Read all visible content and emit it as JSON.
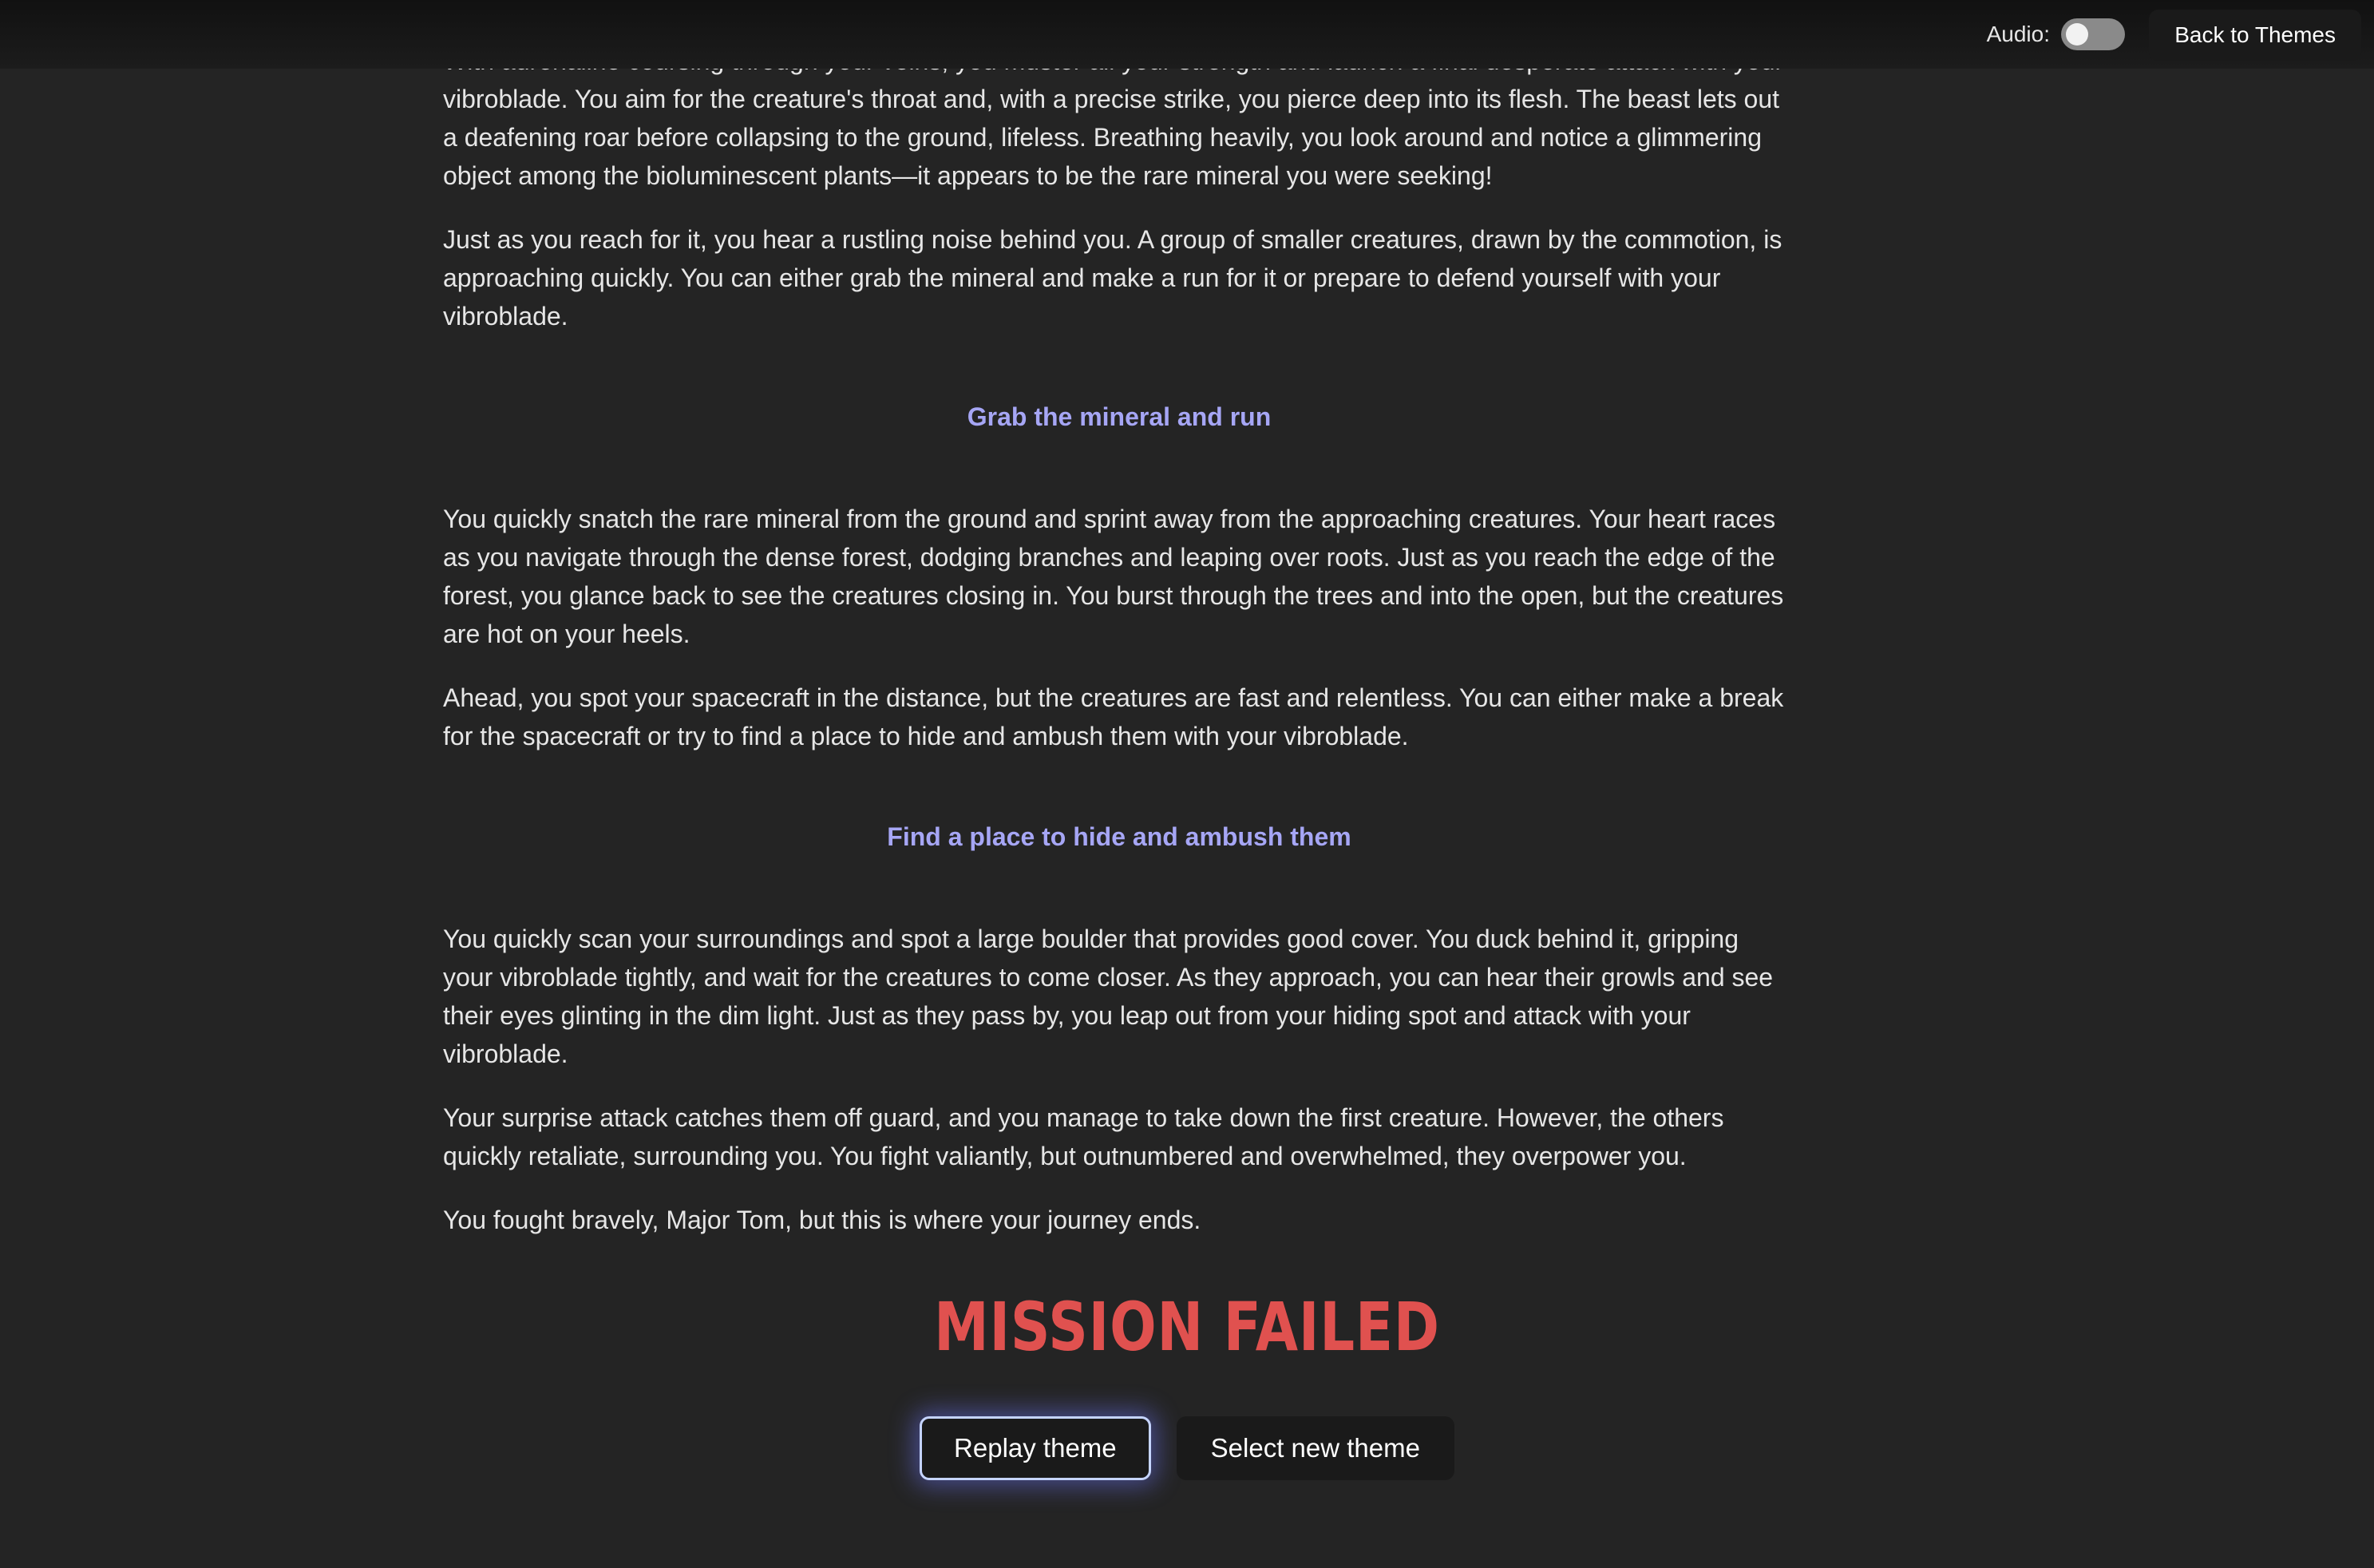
{
  "header": {
    "audio_label": "Audio:",
    "audio_on": false,
    "back_label": "Back to Themes"
  },
  "story": {
    "p1": "With adrenaline coursing through your veins, you muster all your strength and launch a final desperate attack with your vibroblade. You aim for the creature's throat and, with a precise strike, you pierce deep into its flesh. The beast lets out a deafening roar before collapsing to the ground, lifeless. Breathing heavily, you look around and notice a glimmering object among the bioluminescent plants—it appears to be the rare mineral you were seeking!",
    "p2": "Just as you reach for it, you hear a rustling noise behind you. A group of smaller creatures, drawn by the commotion, is approaching quickly. You can either grab the mineral and make a run for it or prepare to defend yourself with your vibroblade.",
    "choice1": "Grab the mineral and run",
    "p3": "You quickly snatch the rare mineral from the ground and sprint away from the approaching creatures. Your heart races as you navigate through the dense forest, dodging branches and leaping over roots. Just as you reach the edge of the forest, you glance back to see the creatures closing in. You burst through the trees and into the open, but the creatures are hot on your heels.",
    "p4": "Ahead, you spot your spacecraft in the distance, but the creatures are fast and relentless. You can either make a break for the spacecraft or try to find a place to hide and ambush them with your vibroblade.",
    "choice2": "Find a place to hide and ambush them",
    "p5": "You quickly scan your surroundings and spot a large boulder that provides good cover. You duck behind it, gripping your vibroblade tightly, and wait for the creatures to come closer. As they approach, you can hear their growls and see their eyes glinting in the dim light. Just as they pass by, you leap out from your hiding spot and attack with your vibroblade.",
    "p6": "Your surprise attack catches them off guard, and you manage to take down the first creature. However, the others quickly retaliate, surrounding you. You fight valiantly, but outnumbered and overwhelmed, they overpower you.",
    "p7": "You fought bravely, Major Tom, but this is where your journey ends."
  },
  "result": {
    "title": "MISSION FAILED",
    "color": "#e0514f"
  },
  "actions": {
    "replay_label": "Replay theme",
    "new_theme_label": "Select new theme"
  }
}
